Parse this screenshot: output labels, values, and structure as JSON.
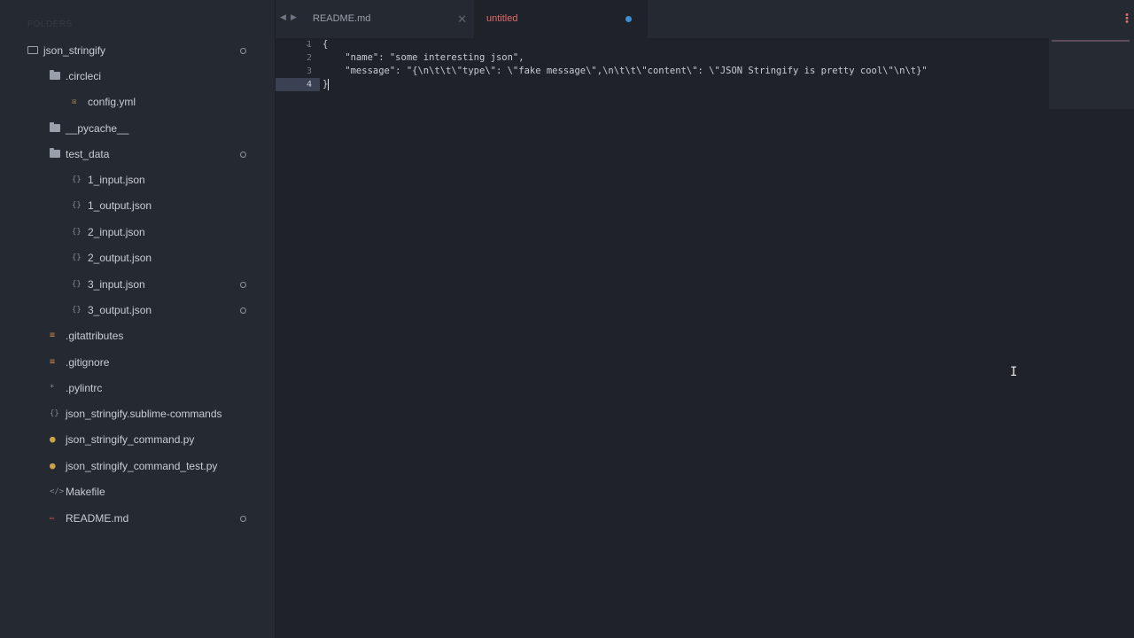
{
  "sidebar": {
    "header": "FOLDERS",
    "items": [
      {
        "label": "json_stringify",
        "icon": "folder-open-icon",
        "dirty": true
      },
      {
        "label": ".circleci",
        "icon": "folder-icon",
        "dirty": false
      },
      {
        "label": "config.yml",
        "icon": "yaml-file-icon",
        "dirty": false
      },
      {
        "label": "__pycache__",
        "icon": "folder-icon",
        "dirty": false
      },
      {
        "label": "test_data",
        "icon": "folder-icon",
        "dirty": true
      },
      {
        "label": "1_input.json",
        "icon": "json-file-icon",
        "dirty": false
      },
      {
        "label": "1_output.json",
        "icon": "json-file-icon",
        "dirty": false
      },
      {
        "label": "2_input.json",
        "icon": "json-file-icon",
        "dirty": false
      },
      {
        "label": "2_output.json",
        "icon": "json-file-icon",
        "dirty": false
      },
      {
        "label": "3_input.json",
        "icon": "json-file-icon",
        "dirty": true
      },
      {
        "label": "3_output.json",
        "icon": "json-file-icon",
        "dirty": true
      },
      {
        "label": ".gitattributes",
        "icon": "text-file-icon",
        "dirty": false
      },
      {
        "label": ".gitignore",
        "icon": "text-file-icon",
        "dirty": false
      },
      {
        "label": ".pylintrc",
        "icon": "config-file-icon",
        "dirty": false
      },
      {
        "label": "json_stringify.sublime-commands",
        "icon": "json-file-icon",
        "dirty": false
      },
      {
        "label": "json_stringify_command.py",
        "icon": "python-file-icon",
        "dirty": false
      },
      {
        "label": "json_stringify_command_test.py",
        "icon": "python-file-icon",
        "dirty": false
      },
      {
        "label": "Makefile",
        "icon": "code-file-icon",
        "dirty": false
      },
      {
        "label": "README.md",
        "icon": "markdown-file-icon",
        "dirty": true
      }
    ]
  },
  "tabs": [
    {
      "label": "README.md",
      "active": false
    },
    {
      "label": "untitled",
      "active": true,
      "dirty": true
    }
  ],
  "editor": {
    "line_numbers": [
      "1",
      "2",
      "3",
      "4"
    ],
    "active_line": "4",
    "lines": [
      "{",
      "    \"name\": \"some interesting json\",",
      "    \"message\": \"{\\n\\t\\t\\\"type\\\": \\\"fake message\\\",\\n\\t\\t\\\"content\\\": \\\"JSON Stringify is pretty cool\\\"\\n\\t}\"",
      "}"
    ]
  },
  "colors": {
    "sidebar_bg": "#252932",
    "editor_bg": "#1f2229",
    "active_tab_text": "#e06c6c",
    "dirty_dot": "#3d8fd1",
    "escape": "#5aa6c4"
  }
}
